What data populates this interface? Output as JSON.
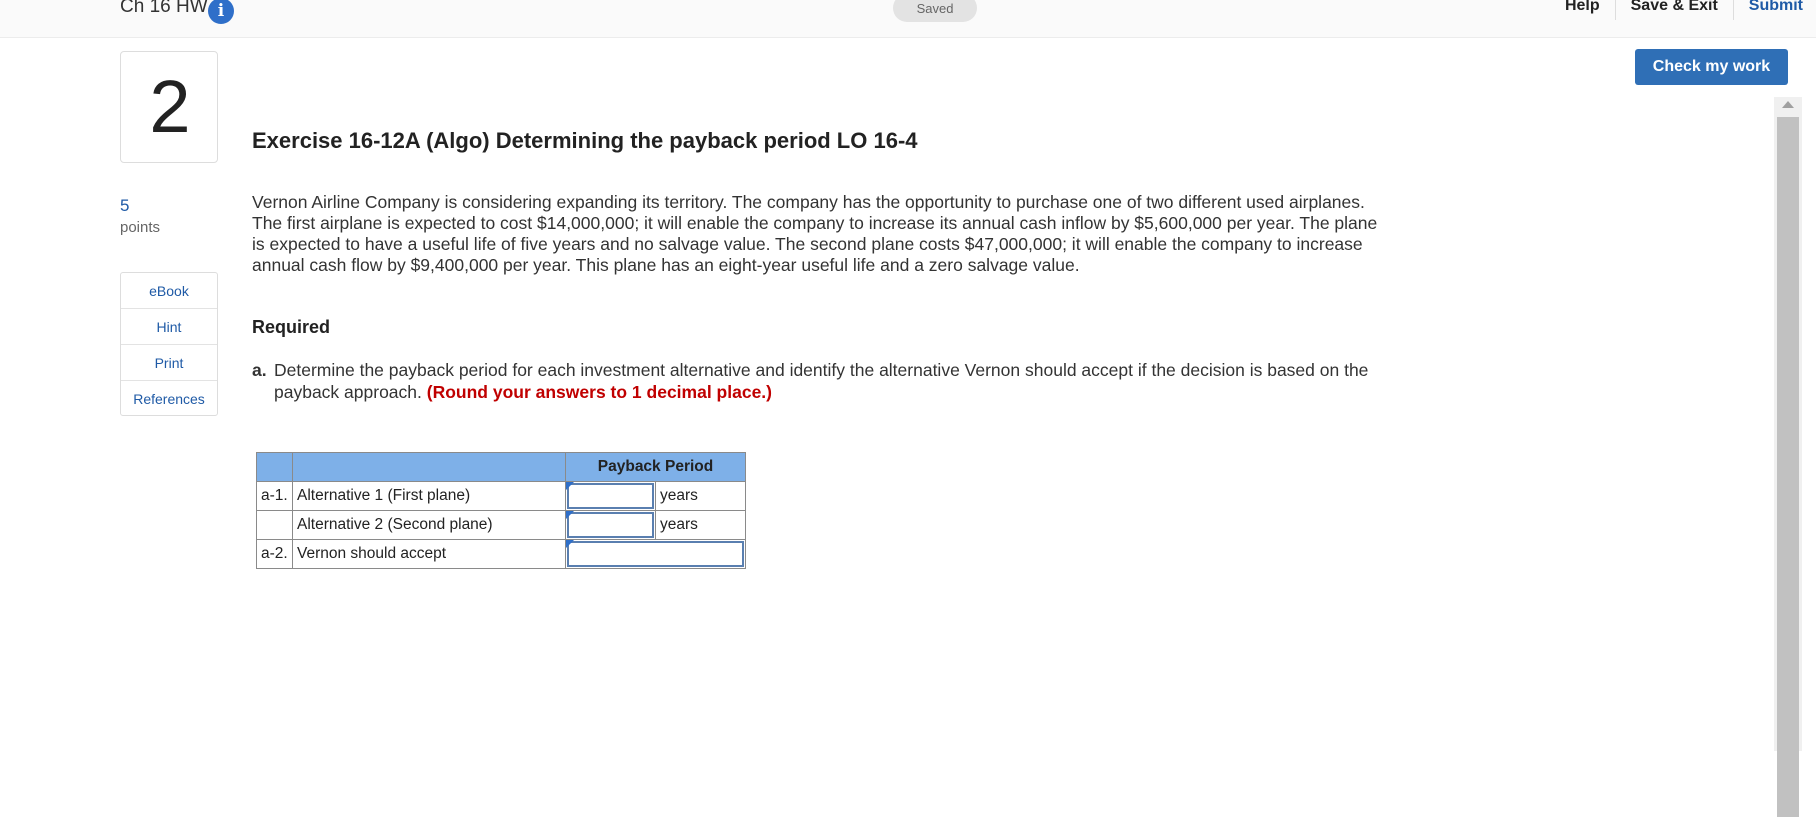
{
  "header": {
    "assignment_title": "Ch 16 HW",
    "status": "Saved",
    "nav": [
      "Help",
      "Save & Exit",
      "Submit"
    ],
    "check_button": "Check my work"
  },
  "question": {
    "number": "2",
    "points_value": "5",
    "points_label": "points",
    "tools": [
      "eBook",
      "Hint",
      "Print",
      "References"
    ]
  },
  "exercise": {
    "title": "Exercise 16-12A (Algo) Determining the payback period LO 16-4",
    "body": "Vernon Airline Company is considering expanding its territory. The company has the opportunity to purchase one of two different used airplanes. The first airplane is expected to cost $14,000,000; it will enable the company to increase its annual cash inflow by $5,600,000 per year. The plane is expected to have a useful life of five years and no salvage value. The second plane costs $47,000,000; it will enable the company to increase annual cash flow by $9,400,000 per year. This plane has an eight-year useful life and a zero salvage value.",
    "required_label": "Required",
    "req_a_label": "a.",
    "req_a_text": "Determine the payback period for each investment alternative and identify the alternative Vernon should accept if the decision is based on the payback approach.",
    "req_a_instruction": "(Round your answers to 1 decimal place.)"
  },
  "table": {
    "header": "Payback Period",
    "rows": [
      {
        "code": "a-1.",
        "label": "Alternative 1 (First plane)",
        "value": "",
        "unit": "years"
      },
      {
        "code": "",
        "label": "Alternative 2 (Second plane)",
        "value": "",
        "unit": "years"
      },
      {
        "code": "a-2.",
        "label": "Vernon should accept",
        "value": ""
      }
    ]
  }
}
